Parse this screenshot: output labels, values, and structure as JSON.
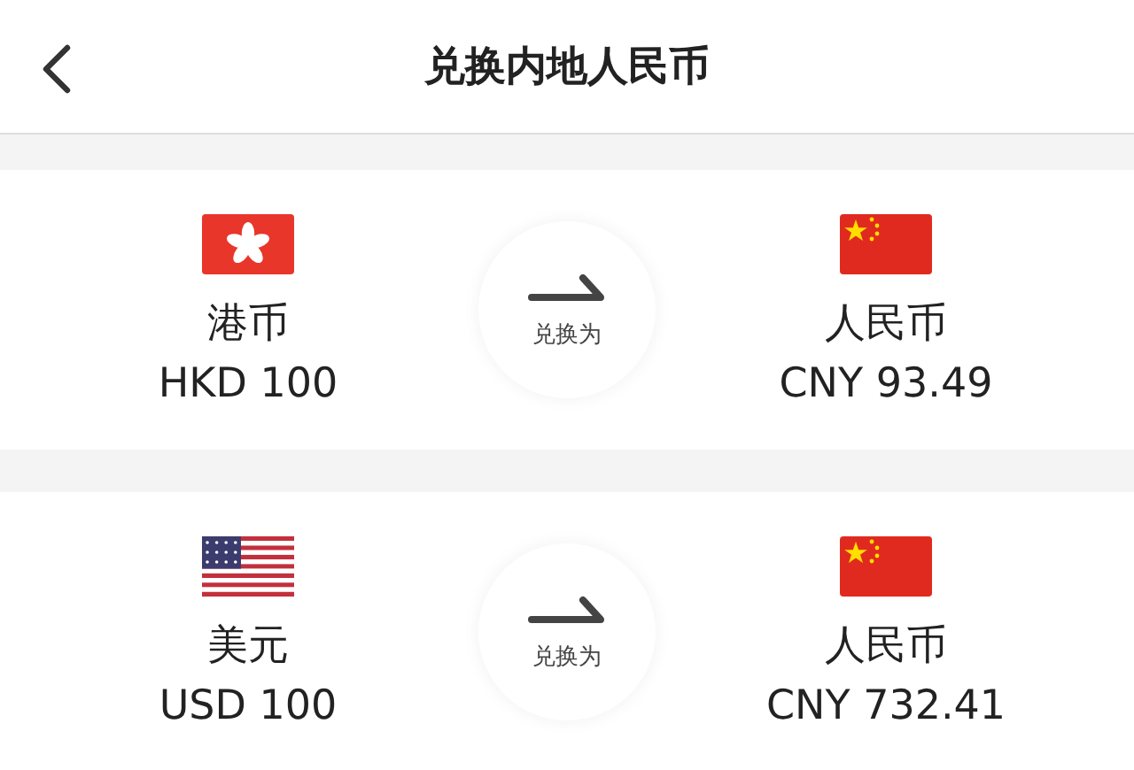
{
  "header": {
    "title": "兑换内地人民币"
  },
  "conversions": [
    {
      "from": {
        "name": "港币",
        "amount": "HKD 100"
      },
      "action": "兑换为",
      "to": {
        "name": "人民币",
        "amount": "CNY 93.49"
      }
    },
    {
      "from": {
        "name": "美元",
        "amount": "USD 100"
      },
      "action": "兑换为",
      "to": {
        "name": "人民币",
        "amount": "CNY 732.41"
      }
    }
  ]
}
